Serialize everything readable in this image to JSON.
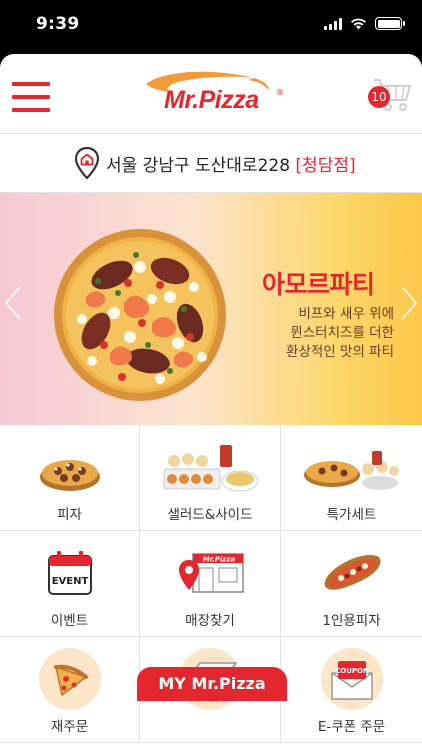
{
  "status_bar": {
    "time": "9:39"
  },
  "header": {
    "logo_text": "Mr.Pizza",
    "logo_mark": "®",
    "cart_count": "10"
  },
  "location": {
    "address": "서울 강남구 도산대로228",
    "branch": "[청담점]"
  },
  "banner": {
    "title": "아모르파티",
    "description": [
      "비프와 새우 위에",
      "뮌스터치즈를 더한",
      "환상적인 맛의 파티"
    ]
  },
  "menu": [
    {
      "label": "피자",
      "icon": "pizza-icon"
    },
    {
      "label": "샐러드&사이드",
      "icon": "salad-side-icon"
    },
    {
      "label": "특가세트",
      "icon": "special-set-icon"
    },
    {
      "label": "이벤트",
      "icon": "event-calendar-icon"
    },
    {
      "label": "매장찾기",
      "icon": "store-finder-icon"
    },
    {
      "label": "1인용피자",
      "icon": "single-pizza-icon"
    },
    {
      "label": "재주문",
      "icon": "reorder-icon"
    },
    {
      "label": "",
      "icon": "pizza-box-icon"
    },
    {
      "label": "E-쿠폰 주문",
      "icon": "coupon-icon"
    }
  ],
  "bottom_tab": {
    "label": "MY Mr.Pizza"
  },
  "colors": {
    "brand_red": "#e4262f",
    "logo_orange": "#f39a3b"
  }
}
